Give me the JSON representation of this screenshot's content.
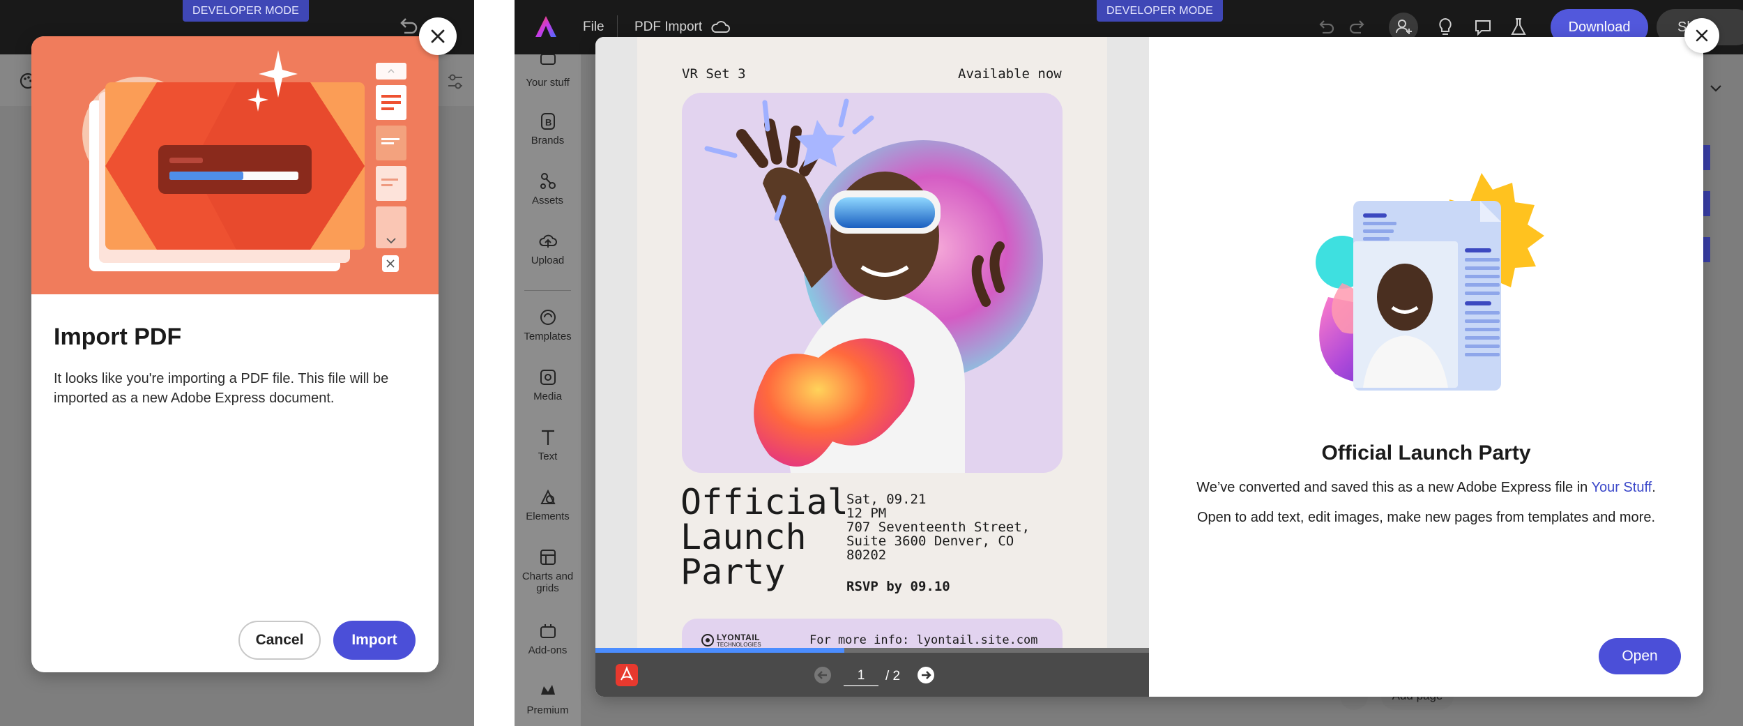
{
  "left": {
    "developer_badge": "DEVELOPER MODE",
    "dialog": {
      "title": "Import PDF",
      "description": "It looks like you're importing a PDF file. This file will be imported as a new Adobe Express document.",
      "cancel_label": "Cancel",
      "import_label": "Import",
      "close_icon": "close-icon"
    }
  },
  "right": {
    "topbar": {
      "file_label": "File",
      "doc_title": "PDF Import",
      "developer_badge": "DEVELOPER MODE",
      "download_label": "Download",
      "share_label": "Sh"
    },
    "sidebar": {
      "items": [
        {
          "label": "Your stuff",
          "icon": "folder-icon"
        },
        {
          "label": "Brands",
          "icon": "brand-icon"
        },
        {
          "label": "Assets",
          "icon": "assets-icon"
        },
        {
          "label": "Upload",
          "icon": "upload-icon"
        },
        {
          "label": "Templates",
          "icon": "templates-icon"
        },
        {
          "label": "Media",
          "icon": "media-icon"
        },
        {
          "label": "Text",
          "icon": "text-icon"
        },
        {
          "label": "Elements",
          "icon": "elements-icon"
        },
        {
          "label": "Charts and grids",
          "icon": "charts-icon"
        },
        {
          "label": "Add-ons",
          "icon": "addons-icon"
        },
        {
          "label": "Premium",
          "icon": "premium-icon"
        }
      ]
    },
    "background_add_page": "Add page",
    "preview": {
      "header_left": "VR Set 3",
      "header_right": "Available now",
      "headline": [
        "Official",
        "Launch",
        "Party"
      ],
      "details": [
        "Sat, 09.21",
        "12 PM",
        "707 Seventeenth Street,",
        "Suite 3600 Denver, CO",
        "80202"
      ],
      "rsvp": "RSVP by 09.10",
      "brand_name": "LYONTAIL",
      "brand_sub": "TECHNOLOGIES",
      "more_info": "For more info: lyontail.site.com",
      "page_current": "1",
      "page_total": "/ 2",
      "progress_fraction": 0.45
    },
    "info": {
      "title": "Official Launch Party",
      "line1_prefix": "We’ve converted and saved this as a new Adobe Express file in ",
      "line1_link": "Your Stuff",
      "line1_suffix": ".",
      "line2": "Open to add text, edit images, make new pages from templates and more.",
      "open_label": "Open"
    },
    "accent_color": "#4b4fd8"
  }
}
